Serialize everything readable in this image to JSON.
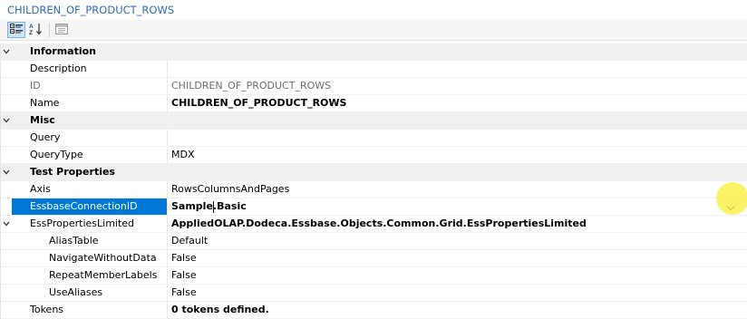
{
  "title": "CHILDREN_OF_PRODUCT_ROWS",
  "toolbar": {
    "buttons": [
      {
        "icon": "categorized-icon",
        "active": true
      },
      {
        "icon": "alphabetical-sort-icon",
        "active": false
      },
      {
        "icon": "property-pages-icon",
        "active": false
      }
    ]
  },
  "categories": {
    "information": "Information",
    "misc": "Misc",
    "test": "Test Properties"
  },
  "props": {
    "description": {
      "label": "Description",
      "value": ""
    },
    "id": {
      "label": "ID",
      "value": "CHILDREN_OF_PRODUCT_ROWS"
    },
    "name": {
      "label": "Name",
      "value": "CHILDREN_OF_PRODUCT_ROWS"
    },
    "query": {
      "label": "Query",
      "value": ""
    },
    "querytype": {
      "label": "QueryType",
      "value": "MDX"
    },
    "axis": {
      "label": "Axis",
      "value": "RowsColumnsAndPages"
    },
    "essbase_connection": {
      "label": "EssbaseConnectionID",
      "value": "Sample.Basic"
    },
    "ess_props": {
      "label": "EssPropertiesLimited",
      "value": "AppliedOLAP.Dodeca.Essbase.Objects.Common.Grid.EssPropertiesLimited"
    },
    "alias_table": {
      "label": "AliasTable",
      "value": "Default"
    },
    "navigate_without_data": {
      "label": "NavigateWithoutData",
      "value": "False"
    },
    "repeat_member_labels": {
      "label": "RepeatMemberLabels",
      "value": "False"
    },
    "use_aliases": {
      "label": "UseAliases",
      "value": "False"
    },
    "tokens": {
      "label": "Tokens",
      "value": "0 tokens defined."
    }
  },
  "colors": {
    "title": "#2f6ab1",
    "selection": "#0078d7",
    "category_bg": "#f0f0f0",
    "highlight": "#f8ee3c"
  }
}
